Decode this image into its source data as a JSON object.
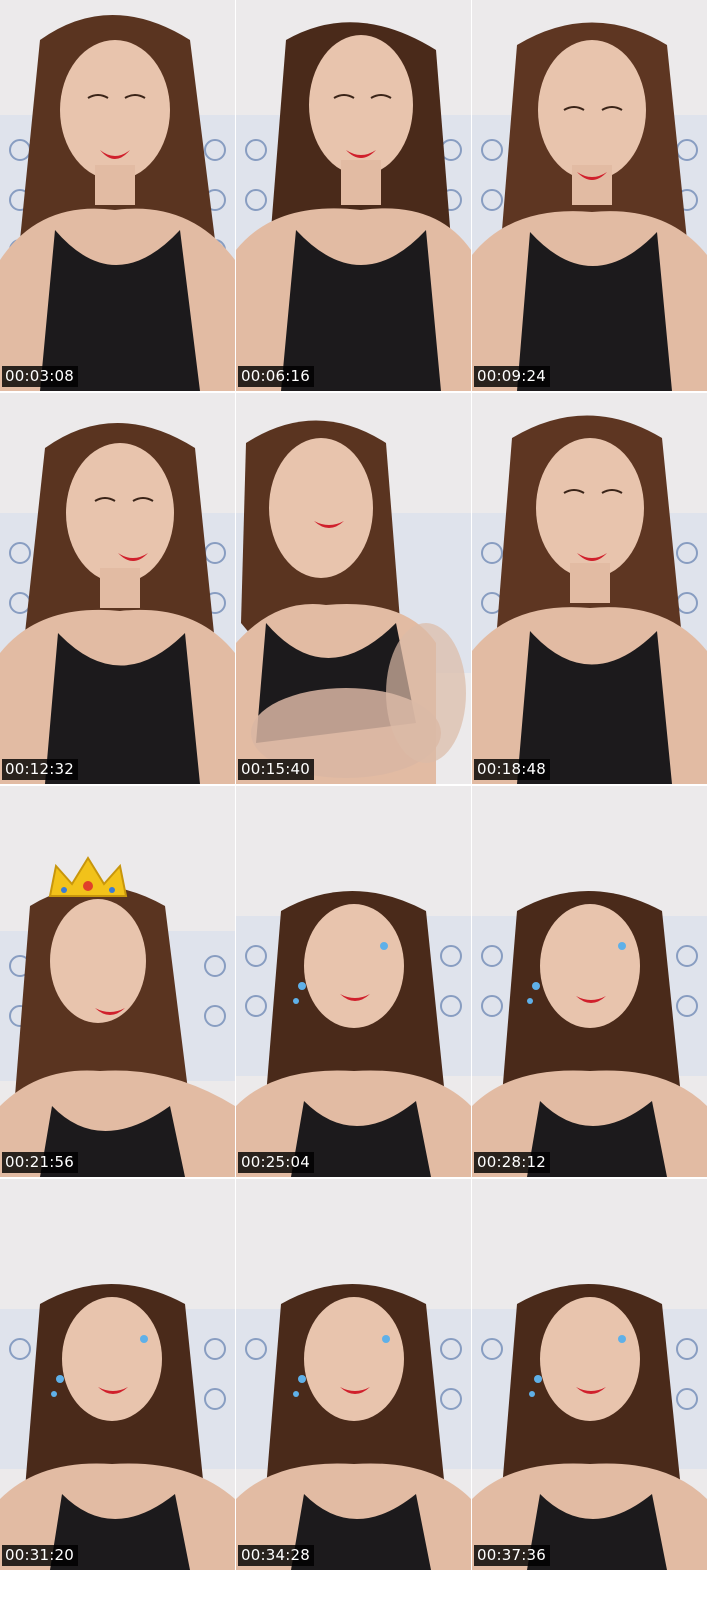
{
  "contact_sheet": {
    "colors": {
      "background": "#ffffff",
      "wall": "#eceaeb",
      "tile_blue": "#4f6fa6",
      "hair": "#5a3420",
      "skin": "#e8c4ad",
      "top": "#1c1a1c",
      "lips": "#d0202c",
      "crown": "#f2c21a",
      "timestamp_bg": "#000000",
      "timestamp_text": "#ffffff"
    },
    "frames": [
      {
        "timestamp": "00:03:08",
        "overlay": "none"
      },
      {
        "timestamp": "00:06:16",
        "overlay": "none"
      },
      {
        "timestamp": "00:09:24",
        "overlay": "none"
      },
      {
        "timestamp": "00:12:32",
        "overlay": "none"
      },
      {
        "timestamp": "00:15:40",
        "overlay": "motion-blur-hand"
      },
      {
        "timestamp": "00:18:48",
        "overlay": "none"
      },
      {
        "timestamp": "00:21:56",
        "overlay": "crown-icon"
      },
      {
        "timestamp": "00:25:04",
        "overlay": "sparkle-icon"
      },
      {
        "timestamp": "00:28:12",
        "overlay": "sparkle-icon"
      },
      {
        "timestamp": "00:31:20",
        "overlay": "sparkle-icon"
      },
      {
        "timestamp": "00:34:28",
        "overlay": "sparkle-icon"
      },
      {
        "timestamp": "00:37:36",
        "overlay": "sparkle-icon"
      }
    ]
  }
}
